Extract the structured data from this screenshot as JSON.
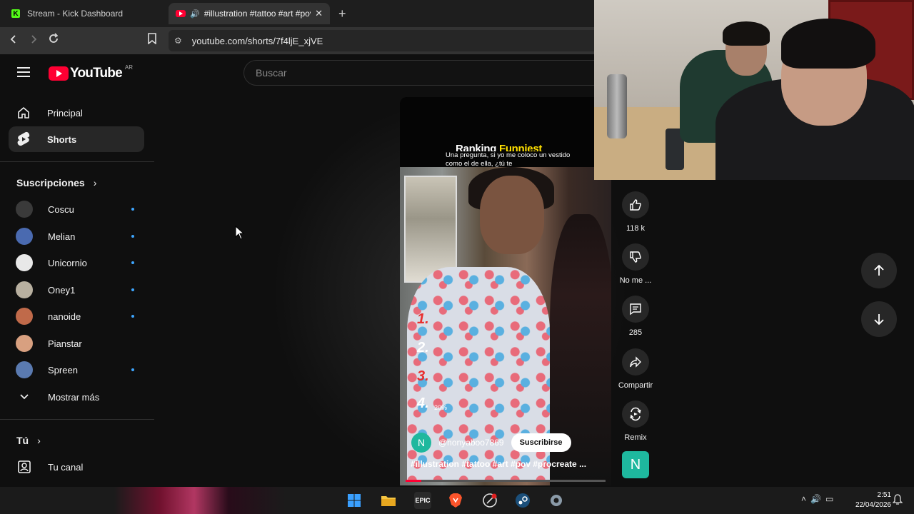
{
  "browser": {
    "tabs": [
      {
        "title": "Stream - Kick Dashboard",
        "active": false
      },
      {
        "title": "#illustration #tattoo #art #pov",
        "active": true
      }
    ],
    "url": "youtube.com/shorts/7f4ljE_xjVE"
  },
  "youtube": {
    "logo_text": "YouTube",
    "country": "AR",
    "search_placeholder": "Buscar",
    "nav": [
      {
        "label": "Principal",
        "icon": "home-icon"
      },
      {
        "label": "Shorts",
        "icon": "shorts-icon",
        "active": true
      }
    ],
    "subscriptions_title": "Suscripciones",
    "subscriptions": [
      {
        "name": "Coscu",
        "color": "#3a3a3a",
        "new": true
      },
      {
        "name": "Melian",
        "color": "#4a6ab0",
        "new": true
      },
      {
        "name": "Unicornio",
        "color": "#e8e8e8",
        "new": true
      },
      {
        "name": "Oney1",
        "color": "#b8b0a0",
        "new": true
      },
      {
        "name": "nanoide",
        "color": "#c06a4a",
        "new": true
      },
      {
        "name": "Pianstar",
        "color": "#d8a080",
        "new": false
      },
      {
        "name": "Spreen",
        "color": "#5a7ab0",
        "new": true
      }
    ],
    "show_more": "Mostrar más",
    "you_title": "Tú",
    "your_channel": "Tu canal"
  },
  "short": {
    "overlay_title_white": "Ranking ",
    "overlay_title_yellow": "Funniest",
    "question": "Una pregunta, si yo me coloco un vestido como el de ella, ¿tú te",
    "ranks": [
      "1.",
      "2.",
      "3.",
      "4."
    ],
    "rank_colors": [
      "#e83030",
      "#ffffff",
      "#e83030",
      "#ffffff"
    ],
    "percent": "20%",
    "channel_initial": "N",
    "channel_name": "@nonyaboo7869",
    "subscribe": "Suscribirse",
    "title": "#illustration #tattoo #art #pov #procreate ...",
    "progress": 0.08
  },
  "actions": [
    {
      "label": "118 k",
      "icon": "thumbs-up-icon"
    },
    {
      "label": "No me ...",
      "icon": "thumbs-down-icon"
    },
    {
      "label": "285",
      "icon": "comment-icon"
    },
    {
      "label": "Compartir",
      "icon": "share-icon"
    },
    {
      "label": "Remix",
      "icon": "remix-icon"
    }
  ],
  "sound_avatar_initial": "N",
  "taskbar": {
    "epic_label": "EPIC",
    "time": "2:51",
    "date": "22/04/2026"
  }
}
